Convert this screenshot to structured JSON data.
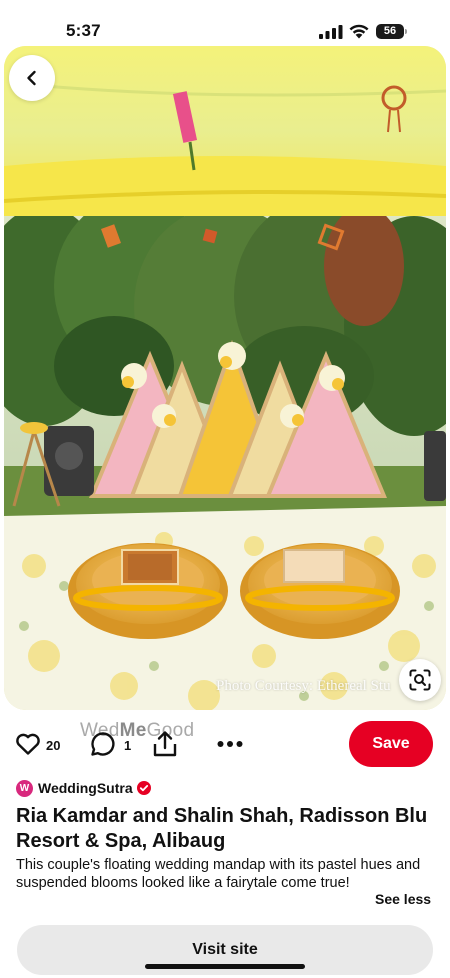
{
  "status_bar": {
    "time": "5:37",
    "battery": "56",
    "icons": [
      "cellular-signal-icon",
      "wifi-icon",
      "battery-icon"
    ]
  },
  "pin": {
    "photo_credit": "Photo Courtesy: Ethereal Stu",
    "watermark": {
      "part1": "Wed",
      "part2": "Me",
      "part3": "Good"
    },
    "likes": "20",
    "comments": "1",
    "save_label": "Save",
    "creator": {
      "initial": "W",
      "name": "WeddingSutra",
      "verified": true
    },
    "title": "Ria Kamdar and Shalin Shah, Radisson Blu Resort & Spa, Alibaug",
    "description": "This couple's floating wedding mandap with its pastel hues and suspended blooms looked like a fairytale come true!",
    "see_less_label": "See less",
    "visit_site_label": "Visit site"
  },
  "colors": {
    "accent": "#e60023",
    "verified": "#e60023",
    "avatar": "#d8287d",
    "visit_button_bg": "#e9e9e9"
  }
}
